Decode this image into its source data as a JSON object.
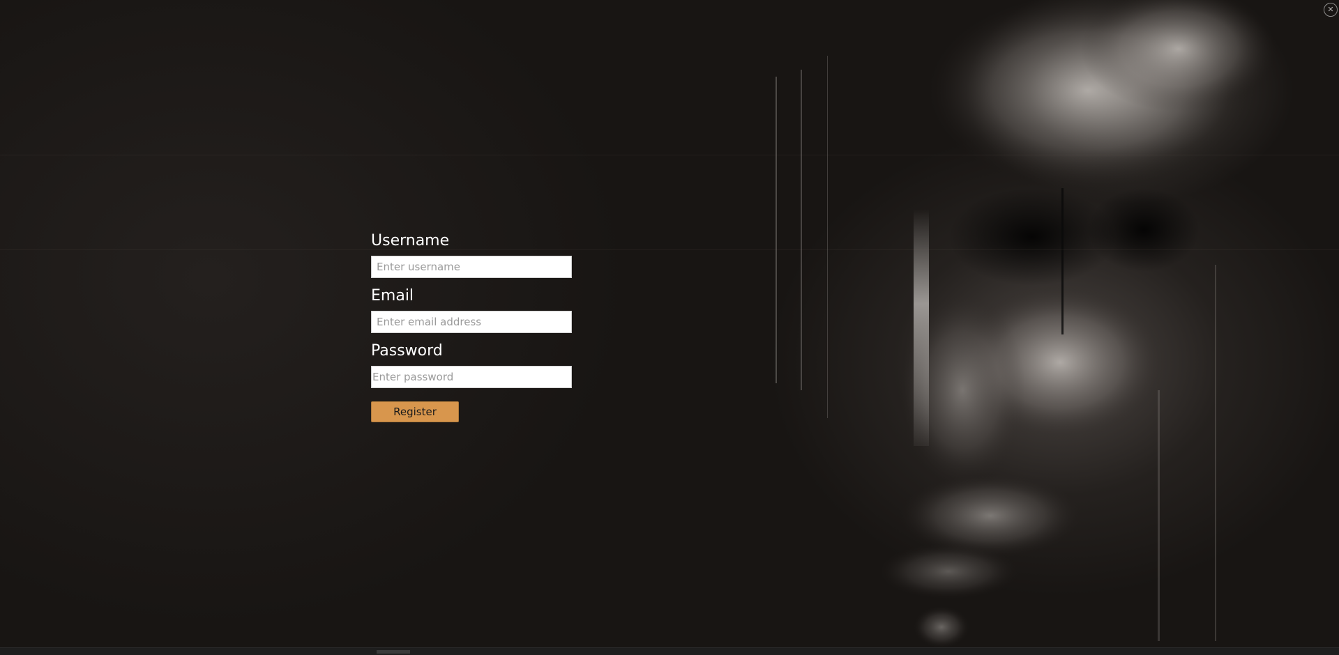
{
  "form": {
    "username_label": "Username",
    "username_placeholder": "Enter username",
    "email_label": "Email",
    "email_placeholder": "Enter email address",
    "password_label": "Password",
    "password_placeholder": "Enter password",
    "register_label": "Register"
  },
  "colors": {
    "background": "#1c1917",
    "label_text": "#ffffff",
    "button_fill": "#d8964d"
  },
  "icons": {
    "corner": "close-circle-icon"
  }
}
